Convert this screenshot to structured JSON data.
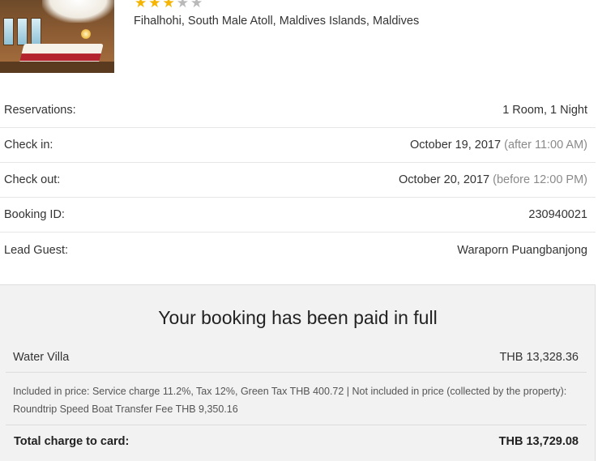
{
  "hotel": {
    "rating_stars": 3,
    "rating_max": 5,
    "address": "Fihalhohi, South Male Atoll, Maldives Islands, Maldives"
  },
  "details": {
    "reservations": {
      "label": "Reservations:",
      "value": "1 Room, 1 Night"
    },
    "check_in": {
      "label": "Check in:",
      "date": "October 19, 2017",
      "note": "(after 11:00 AM)"
    },
    "check_out": {
      "label": "Check out:",
      "date": "October 20, 2017",
      "note": "(before 12:00 PM)"
    },
    "booking_id": {
      "label": "Booking ID:",
      "value": "230940021"
    },
    "lead_guest": {
      "label": "Lead Guest:",
      "value": "Waraporn Puangbanjong"
    }
  },
  "payment": {
    "title": "Your booking has been paid in full",
    "room_name": "Water Villa",
    "room_price": "THB 13,328.36",
    "price_note": "Included in price: Service charge 11.2%, Tax 12%, Green Tax THB 400.72 | Not included in price (collected by the property): Roundtrip Speed Boat Transfer Fee THB 9,350.16",
    "total_label": "Total charge to card:",
    "total_value": "THB 13,729.08"
  },
  "colors": {
    "star_filled": "#f5b400",
    "star_empty": "#b9b9b9",
    "panel_background": "#f2f2f2",
    "muted_text": "#8a8a8a"
  }
}
